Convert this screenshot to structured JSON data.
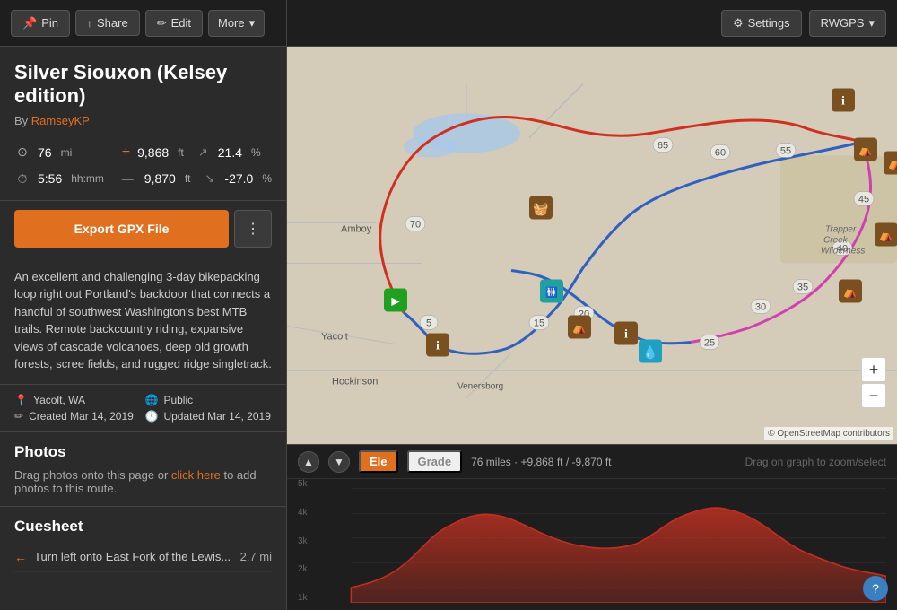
{
  "topbar": {
    "pin_label": "Pin",
    "share_label": "Share",
    "edit_label": "Edit",
    "more_label": "More",
    "settings_label": "Settings",
    "rwgps_label": "RWGPS"
  },
  "route": {
    "title": "Silver Siouxon (Kelsey edition)",
    "author_prefix": "By",
    "author_name": "RamseyKP",
    "stats": {
      "distance_value": "76",
      "distance_unit": "mi",
      "elevation_gain_value": "9,868",
      "elevation_gain_unit": "ft",
      "climb_pct_value": "21.4",
      "climb_pct_unit": "%",
      "time_value": "5:56",
      "time_unit": "hh:mm",
      "elevation_loss_value": "9,870",
      "elevation_loss_unit": "ft",
      "descent_pct_value": "-27.0",
      "descent_pct_unit": "%"
    },
    "export_btn": "Export GPX File",
    "description": "An excellent and challenging 3-day bikepacking loop right out Portland's backdoor that connects a handful of southwest Washington's best MTB trails. Remote backcountry riding, expansive views of cascade volcanoes, deep old growth forests, scree fields, and rugged ridge singletrack.",
    "location": "Yacolt, WA",
    "visibility": "Public",
    "created": "Created Mar 14, 2019",
    "updated": "Updated Mar 14, 2019"
  },
  "photos": {
    "title": "Photos",
    "description_prefix": "Drag photos onto this page or",
    "link_text": "click here",
    "description_suffix": "to add photos to this route."
  },
  "cuesheet": {
    "title": "Cuesheet",
    "items": [
      {
        "direction": "←",
        "text": "Turn left onto East Fork of the Lewis...",
        "distance": "2.7 mi"
      }
    ]
  },
  "elevation": {
    "ele_tab": "Ele",
    "grade_tab": "Grade",
    "stats_text": "76 miles · +9,868 ft / -9,870 ft",
    "drag_hint": "Drag on graph to zoom/select",
    "y_labels": [
      "5k",
      "4k",
      "3k",
      "2k",
      "1k"
    ],
    "nav_up": "▲",
    "nav_down": "▼"
  },
  "map": {
    "attribution": "© OpenStreetMap contributors",
    "zoom_in": "+",
    "zoom_out": "−"
  },
  "icons": {
    "pin": "📌",
    "share": "🔗",
    "edit": "✏",
    "chevron_down": "▾",
    "gear": "⚙",
    "distance_icon": "📍",
    "time_icon": "⏱",
    "location_pin": "📍",
    "globe": "🌐",
    "pencil_created": "✏",
    "clock_updated": "🕐",
    "arrow_up": "↗",
    "arrow_down": "↘",
    "plus": "+",
    "minus": "−"
  }
}
